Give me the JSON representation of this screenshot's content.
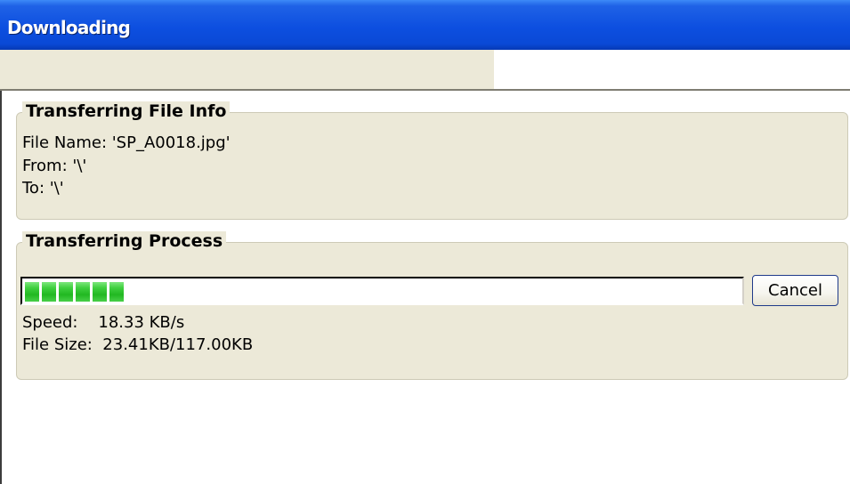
{
  "window": {
    "title": "Downloading"
  },
  "file_info": {
    "legend": "Transferring File Info",
    "file_name": "File Name: 'SP_A0018.jpg'",
    "from": "From: '\\'",
    "to": "To: '\\'"
  },
  "process": {
    "legend": "Transferring Process",
    "progress_fraction": 0.2,
    "progress_segments": 6,
    "cancel_label": "Cancel",
    "speed": "Speed:    18.33 KB/s",
    "file_size": "File Size:  23.41KB/117.00KB"
  },
  "colors": {
    "titlebar": "#0d4fe0",
    "dialog_bg": "#ece9d8",
    "progress_green": "#22b822"
  }
}
